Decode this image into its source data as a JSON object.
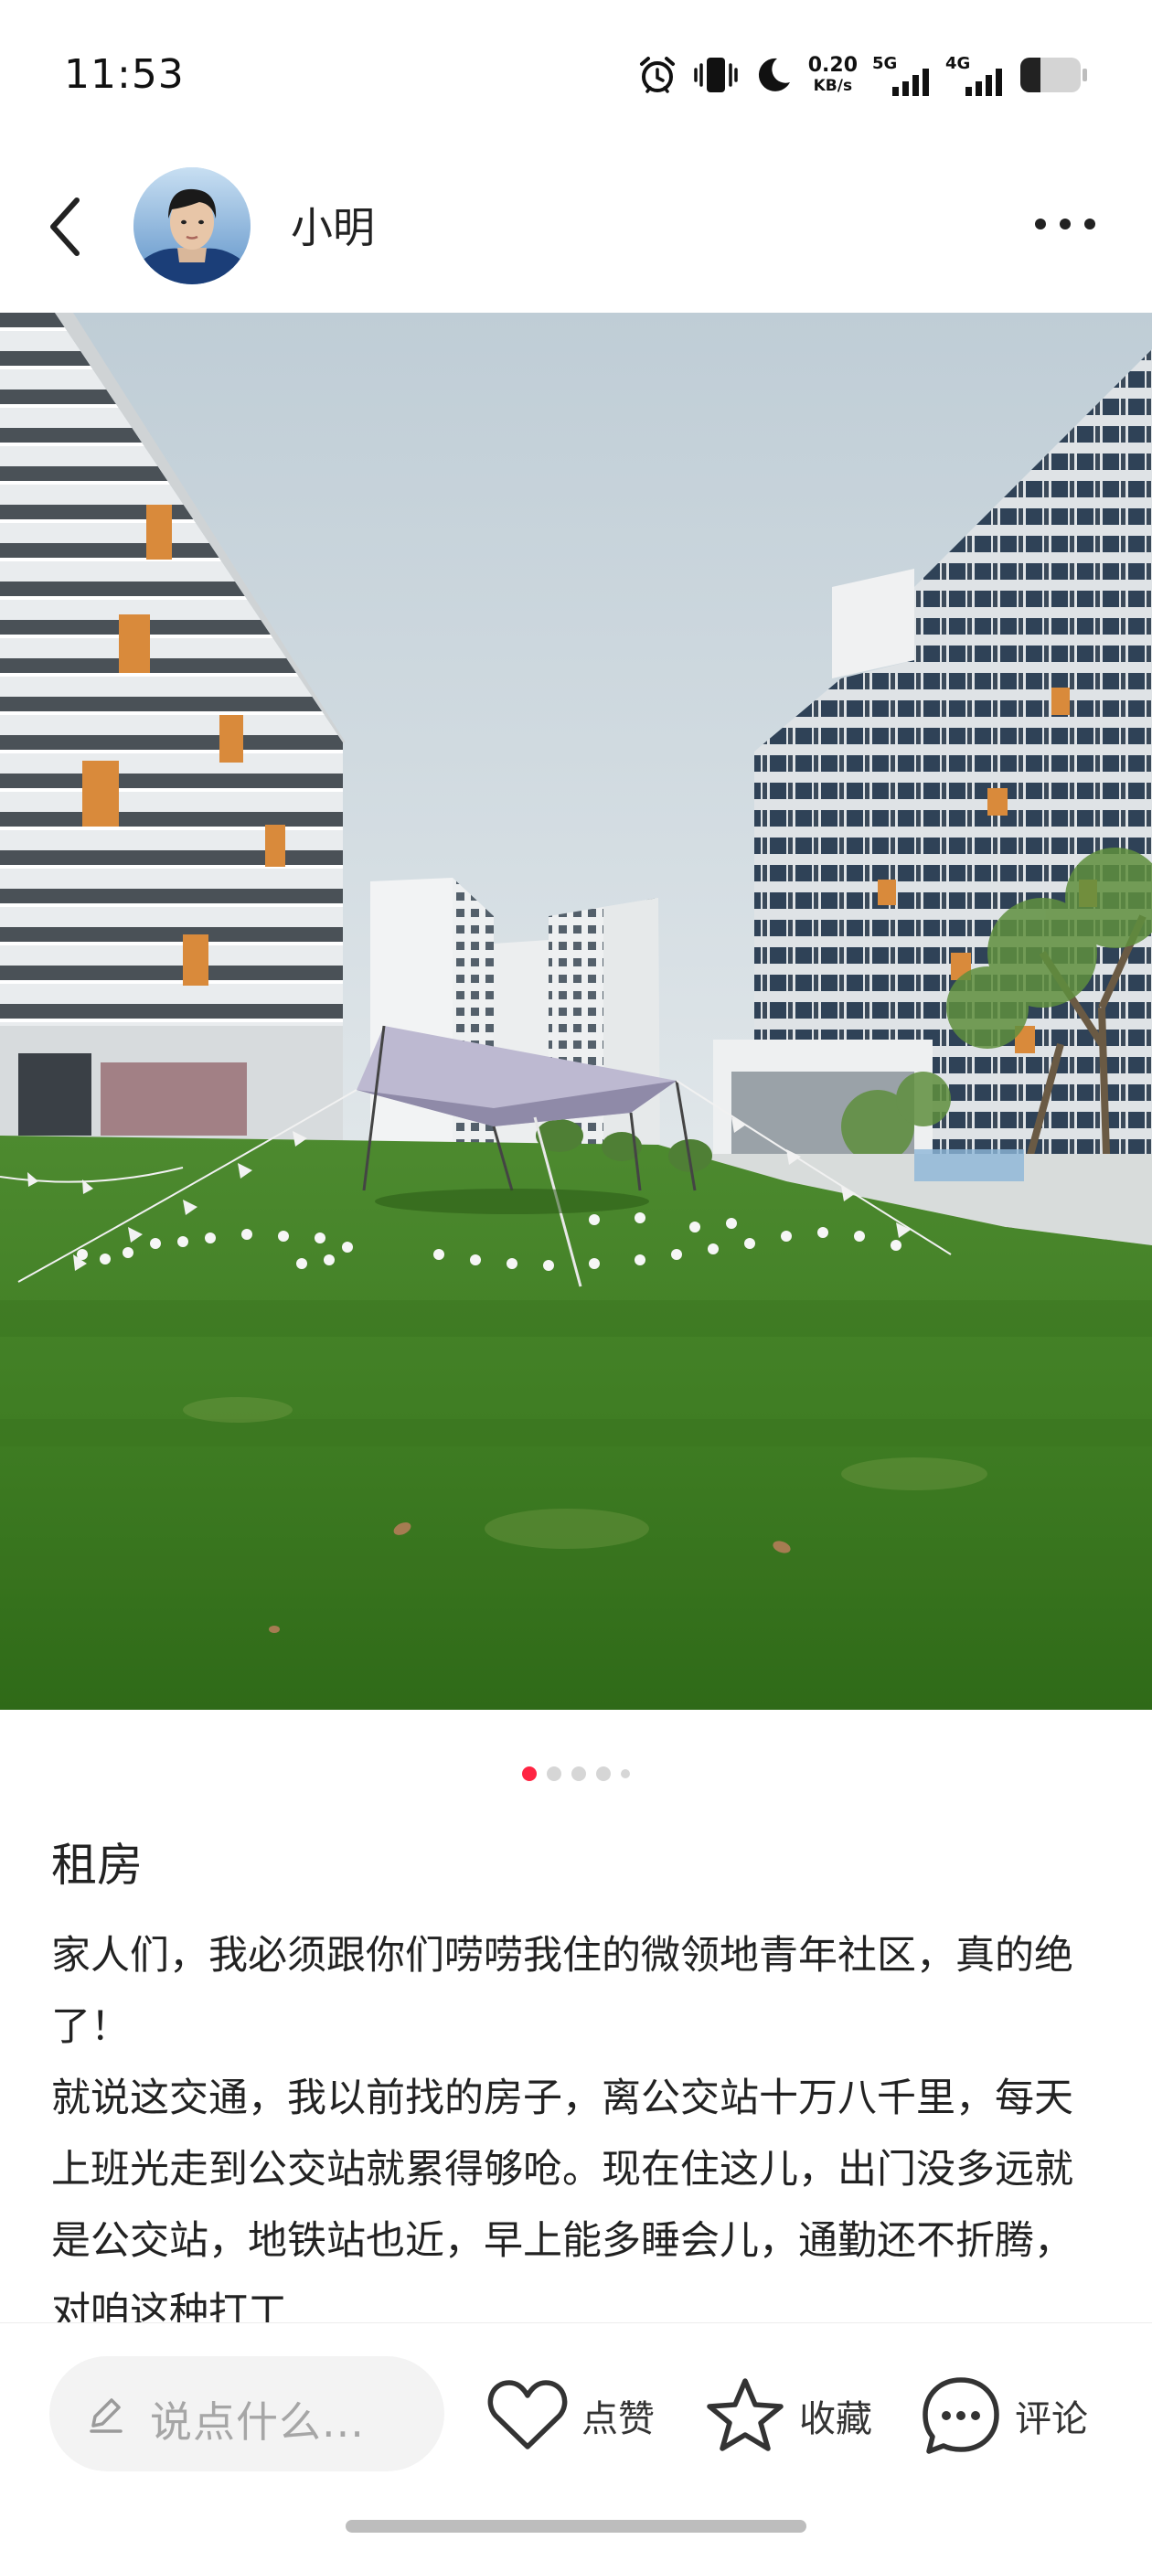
{
  "status_bar": {
    "time": "11:53",
    "net_speed_value": "0.20",
    "net_speed_unit": "KB/s",
    "sim1_label": "5G",
    "sim2_label": "4G",
    "icons": [
      "alarm-icon",
      "vibrate-icon",
      "moon-icon",
      "signal-5g-icon",
      "signal-4g-icon",
      "battery-icon"
    ]
  },
  "header": {
    "username": "小明",
    "icons": [
      "back-icon",
      "avatar",
      "more-icon"
    ]
  },
  "carousel": {
    "image_count_dots": 5,
    "active_index": 0
  },
  "post": {
    "title": "租房",
    "paragraph_1": "家人们，我必须跟你们唠唠我住的微领地青年社区，真的绝了！",
    "paragraph_2": "就说这交通，我以前找的房子，离公交站十万八千里，每天上班光走到公交站就累得够呛。现在住这儿，出门没多远就是公交站，地铁站也近，早上能多睡会儿，通勤还不折腾，对咱这种打工"
  },
  "bottom_bar": {
    "comment_placeholder": "说点什么...",
    "like_label": "点赞",
    "collect_label": "收藏",
    "comment_label": "评论"
  },
  "colors": {
    "accent": "#ff2442",
    "text": "#222222",
    "placeholder": "#a6a6a6",
    "input_bg": "#f3f3f3"
  }
}
